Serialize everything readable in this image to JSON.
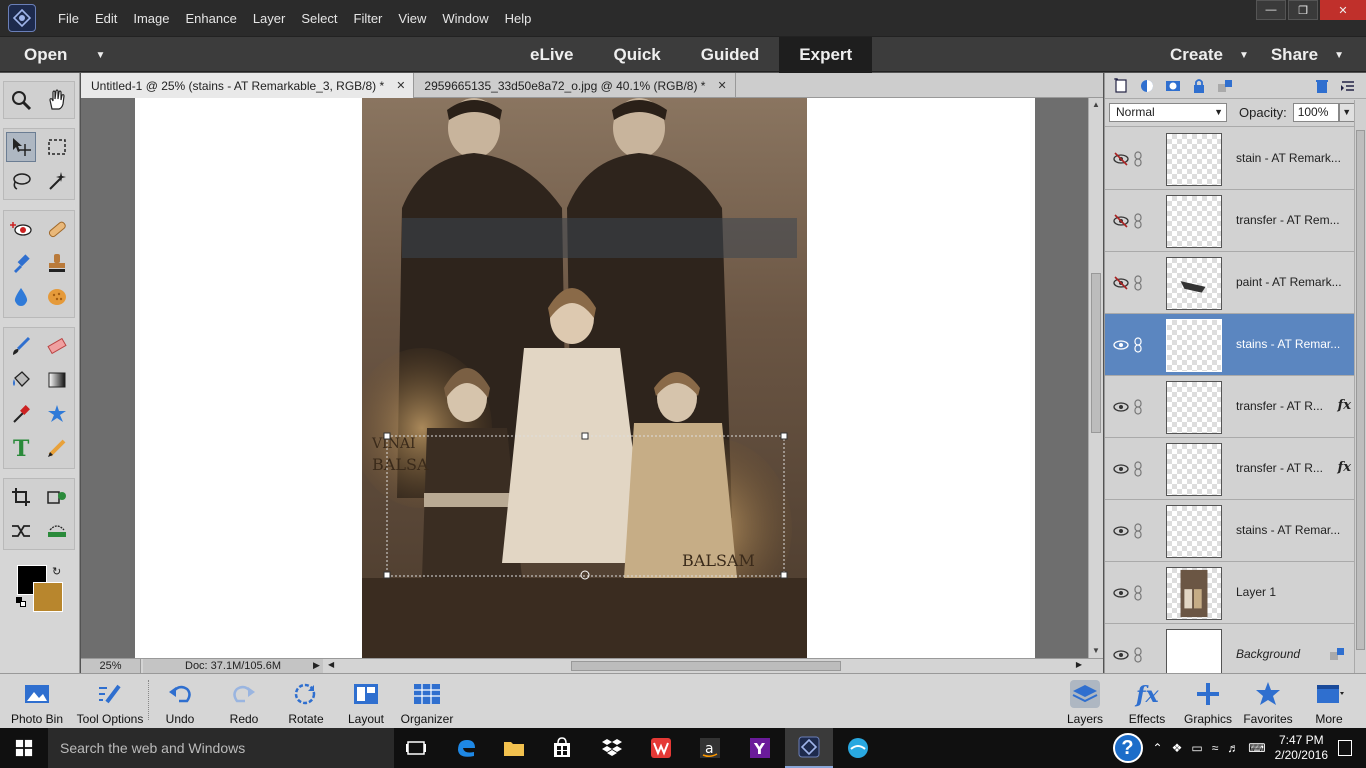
{
  "menu": {
    "items": [
      "File",
      "Edit",
      "Image",
      "Enhance",
      "Layer",
      "Select",
      "Filter",
      "View",
      "Window",
      "Help"
    ]
  },
  "modebar": {
    "open_label": "Open",
    "tabs": [
      "eLive",
      "Quick",
      "Guided",
      "Expert"
    ],
    "active_tab": "Expert",
    "create_label": "Create",
    "share_label": "Share"
  },
  "document_tabs": [
    {
      "title": "Untitled-1 @ 25% (stains - AT Remarkable_3, RGB/8) *",
      "active": true
    },
    {
      "title": "2959665135_33d50e8a72_o.jpg @ 40.1% (RGB/8) *",
      "active": false
    }
  ],
  "statusbar": {
    "zoom": "25%",
    "doc_info": "Doc: 37.1M/105.6M"
  },
  "layers_panel": {
    "blend_mode": "Normal",
    "opacity_label": "Opacity:",
    "opacity_value": "100%",
    "layers": [
      {
        "name": "stain - AT Remark...",
        "visible": false,
        "selected": false,
        "fx": false
      },
      {
        "name": "transfer - AT Rem...",
        "visible": false,
        "selected": false,
        "fx": false
      },
      {
        "name": "paint - AT Remark...",
        "visible": false,
        "selected": false,
        "fx": false
      },
      {
        "name": "stains - AT Remar...",
        "visible": true,
        "selected": true,
        "fx": false
      },
      {
        "name": "transfer - AT R...",
        "visible": true,
        "selected": false,
        "fx": true
      },
      {
        "name": "transfer - AT R...",
        "visible": true,
        "selected": false,
        "fx": true
      },
      {
        "name": "stains - AT Remar...",
        "visible": true,
        "selected": false,
        "fx": false
      },
      {
        "name": "Layer 1",
        "visible": true,
        "selected": false,
        "fx": false
      },
      {
        "name": "Background",
        "visible": true,
        "selected": false,
        "fx": false
      }
    ],
    "fx_symbol": "fx"
  },
  "bottombar": {
    "left": [
      "Photo Bin",
      "Tool Options",
      "Undo",
      "Redo",
      "Rotate",
      "Layout",
      "Organizer"
    ],
    "right": [
      "Layers",
      "Effects",
      "Graphics",
      "Favorites",
      "More"
    ]
  },
  "taskbar": {
    "search_placeholder": "Search the web and Windows",
    "time": "7:47 PM",
    "date": "2/20/2016"
  },
  "colors": {
    "foreground": "#000000",
    "background": "#b8862d",
    "selected_layer": "#5b86c0",
    "active_mode_tab": "#1e1e1e"
  },
  "icons": {
    "toolbox": [
      "zoom-icon",
      "hand-icon",
      "move-icon",
      "marquee-icon",
      "lasso-icon",
      "magic-wand-icon",
      "red-eye-icon",
      "healing-brush-icon",
      "smart-brush-icon",
      "clone-stamp-icon",
      "blur-icon",
      "sponge-icon",
      "brush-icon",
      "eraser-icon",
      "paint-bucket-icon",
      "gradient-icon",
      "eyedropper-icon",
      "custom-shape-icon",
      "type-icon",
      "pencil-icon",
      "crop-icon",
      "recompose-icon",
      "content-aware-move-icon",
      "straighten-icon"
    ]
  }
}
